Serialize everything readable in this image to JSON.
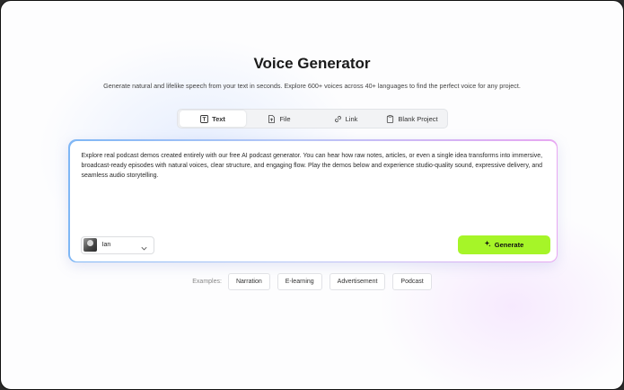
{
  "page": {
    "title": "Voice Generator",
    "subtitle": "Generate natural and lifelike speech from your text in seconds. Explore 600+ voices across 40+ languages to find the perfect voice for any project."
  },
  "tabs": [
    {
      "label": "Text",
      "icon": "text-icon",
      "active": true
    },
    {
      "label": "File",
      "icon": "file-icon",
      "active": false
    },
    {
      "label": "Link",
      "icon": "link-icon",
      "active": false
    },
    {
      "label": "Blank Project",
      "icon": "clipboard-icon",
      "active": false
    }
  ],
  "editor": {
    "text": "Explore real podcast demos created entirely with our free AI podcast generator. You can hear how raw notes, articles, or even a single idea transforms into immersive, broadcast-ready episodes with natural voices, clear structure, and engaging flow. Play the demos below and experience studio-quality sound, expressive delivery, and seamless audio storytelling."
  },
  "voice": {
    "name": "Ian",
    "icon": "chevron-down-icon"
  },
  "generate": {
    "label": "Generate",
    "icon": "sparkle-icon",
    "color": "#a6f528"
  },
  "examples": {
    "label": "Examples:",
    "items": [
      "Narration",
      "E-learning",
      "Advertisement",
      "Podcast"
    ]
  },
  "colors": {
    "accent": "#a6f528",
    "editor_gradient_start": "#7fb7f5",
    "editor_gradient_end": "#e8a8f2"
  }
}
